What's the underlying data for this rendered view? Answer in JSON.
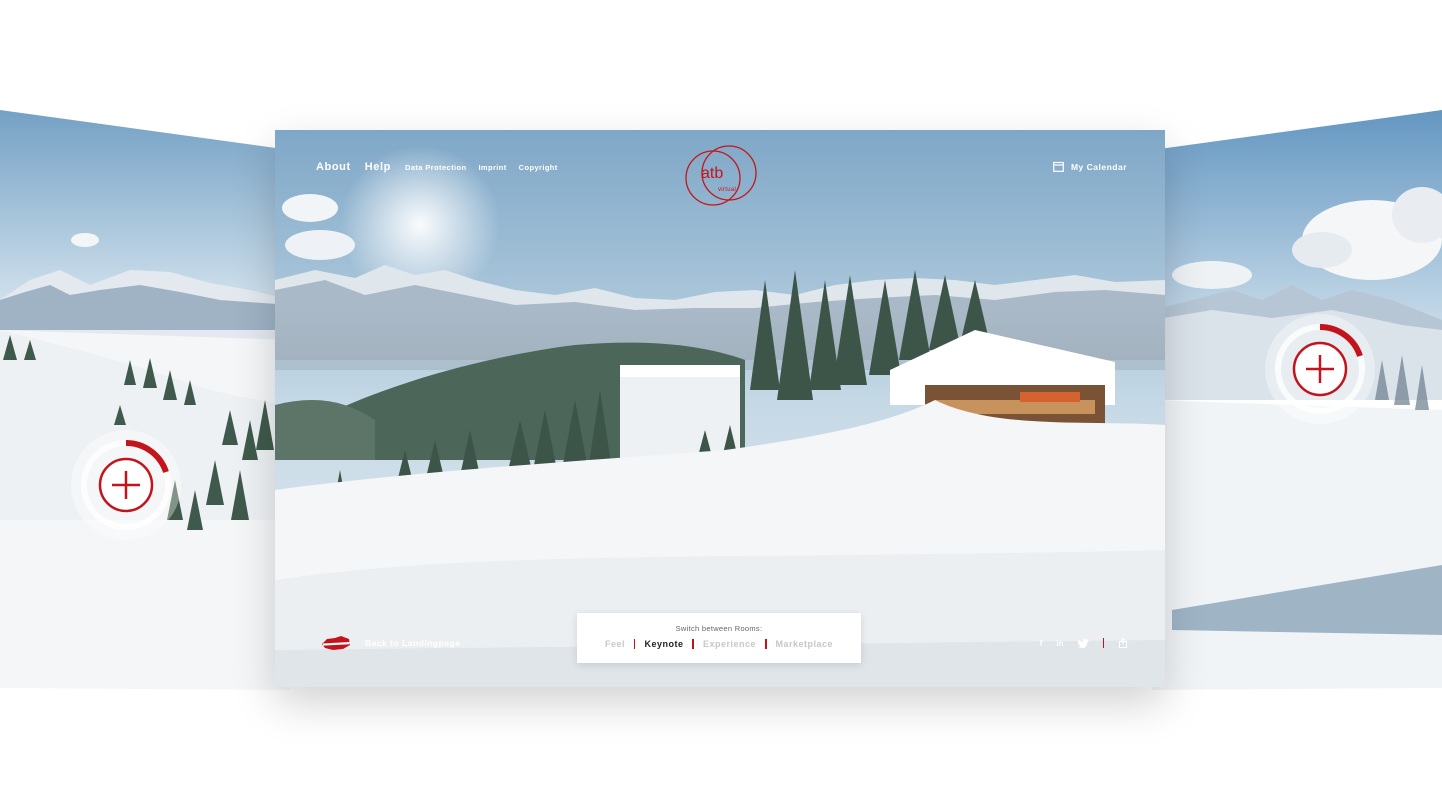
{
  "nav": {
    "about": "About",
    "help": "Help",
    "data_protection": "Data Protection",
    "imprint": "Imprint",
    "copyright": "Copyright"
  },
  "logo": {
    "text": "atb",
    "sub": "virtual"
  },
  "calendar": {
    "label": "My Calendar",
    "icon": "calendar-icon"
  },
  "back": {
    "label": "Back to Landingpage",
    "icon": "austria-flag-icon"
  },
  "switcher": {
    "title": "Switch between Rooms:",
    "rooms": [
      {
        "label": "Feel",
        "active": false
      },
      {
        "label": "Keynote",
        "active": true
      },
      {
        "label": "Experience",
        "active": false
      },
      {
        "label": "Marketplace",
        "active": false
      }
    ]
  },
  "social": {
    "facebook": "f",
    "linkedin": "in",
    "twitter": "twitter-icon",
    "share": "share-icon"
  },
  "hotspots": [
    {
      "icon": "plus-icon",
      "progress": 0.3
    },
    {
      "icon": "plus-icon",
      "progress": 0.3
    }
  ],
  "colors": {
    "accent": "#c4141b",
    "sky": "#8fb4cf",
    "snow": "#f2f4f6"
  }
}
